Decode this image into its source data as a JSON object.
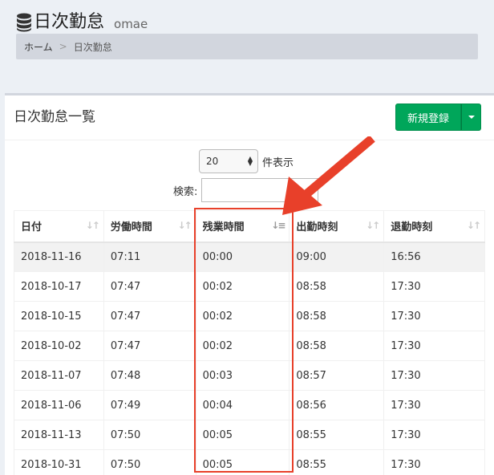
{
  "header": {
    "title": "日次勤怠",
    "subtitle": "omae"
  },
  "breadcrumb": {
    "home": "ホーム",
    "separator": ">",
    "current": "日次勤怠"
  },
  "box": {
    "title": "日次勤怠一覧",
    "new_button_label": "新規登録"
  },
  "length": {
    "selected": "20",
    "suffix": "件表示"
  },
  "search": {
    "label": "検索:",
    "value": ""
  },
  "table": {
    "columns": [
      "日付",
      "労働時間",
      "残業時間",
      "出勤時刻",
      "退勤時刻"
    ],
    "rows": [
      [
        "2018-11-16",
        "07:11",
        "00:00",
        "09:00",
        "16:56"
      ],
      [
        "2018-10-17",
        "07:47",
        "00:02",
        "08:58",
        "17:30"
      ],
      [
        "2018-10-15",
        "07:47",
        "00:02",
        "08:58",
        "17:30"
      ],
      [
        "2018-10-02",
        "07:47",
        "00:02",
        "08:58",
        "17:30"
      ],
      [
        "2018-11-07",
        "07:48",
        "00:03",
        "08:57",
        "17:30"
      ],
      [
        "2018-11-06",
        "07:49",
        "00:04",
        "08:56",
        "17:30"
      ],
      [
        "2018-11-13",
        "07:50",
        "00:05",
        "08:55",
        "17:30"
      ],
      [
        "2018-10-31",
        "07:50",
        "00:05",
        "08:55",
        "17:30"
      ]
    ],
    "sorted_column": "残業時間"
  },
  "colors": {
    "primary_button": "#00a65a",
    "annotation": "#e8402a"
  },
  "icons": {
    "title_icon": "database-icon",
    "sort_icon": "sort-icon",
    "sort_active_icon": "sort-amount-asc-icon"
  }
}
